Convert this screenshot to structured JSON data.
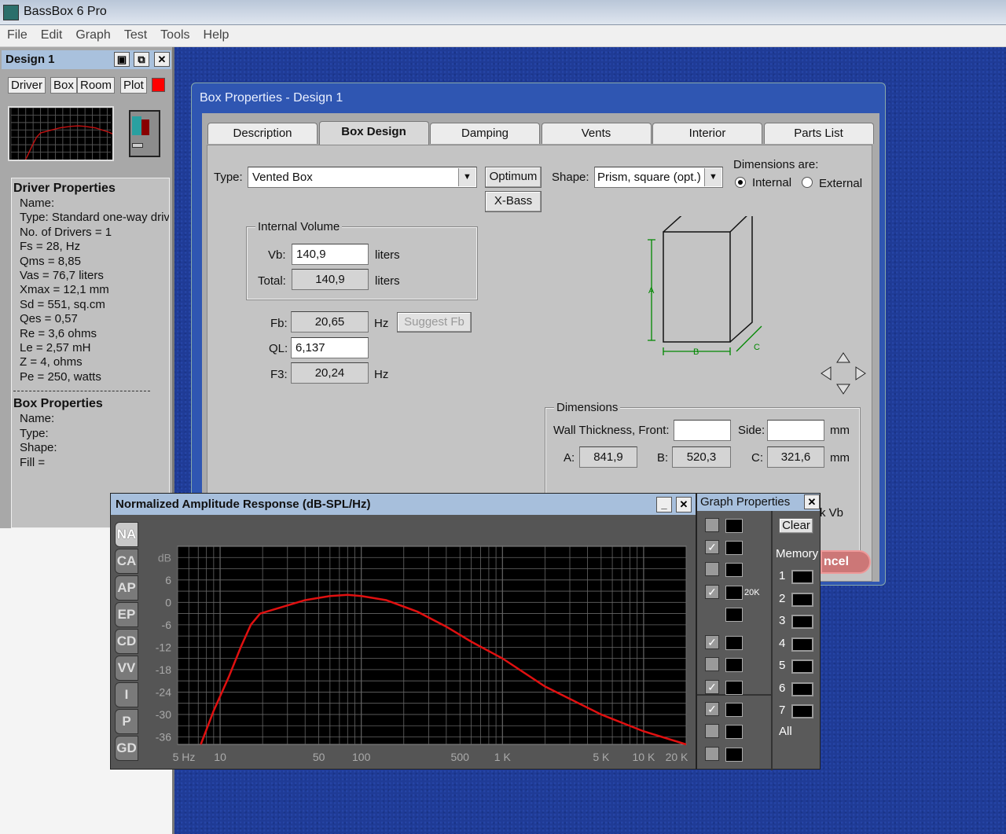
{
  "app": {
    "title": "BassBox 6 Pro"
  },
  "menu": [
    "File",
    "Edit",
    "Graph",
    "Test",
    "Tools",
    "Help"
  ],
  "design": {
    "title": "Design 1",
    "buttons": [
      "Driver",
      "Box",
      "Room",
      "Plot"
    ],
    "plot_color": "#ff0000",
    "driver_heading": "Driver Properties",
    "driver_lines": [
      "Name:",
      "Type: Standard one-way driver",
      "No. of Drivers = 1",
      "Fs =  28, Hz",
      "Qms =  8,85",
      "Vas =  76,7 liters",
      "Xmax =  12,1 mm",
      "Sd =  551, sq.cm",
      "Qes =  0,57",
      "Re =  3,6 ohms",
      "Le =  2,57 mH",
      "Z =  4, ohms",
      "Pe =  250, watts"
    ],
    "box_heading": "Box Properties",
    "box_lines": [
      "Name:",
      "Type:",
      "Shape:",
      "Fill ="
    ]
  },
  "dialog": {
    "title": "Box Properties - Design 1",
    "tabs": [
      "Description",
      "Box Design",
      "Damping",
      "Vents",
      "Interior",
      "Parts List"
    ],
    "selected_tab": "Box Design",
    "type_label": "Type:",
    "type_value": "Vented Box",
    "optimum": "Optimum",
    "xbass": "X-Bass",
    "shape_label": "Shape:",
    "shape_value": "Prism, square (opt.)",
    "dims_are": "Dimensions are:",
    "internal": "Internal",
    "external": "External",
    "dims_selected": "Internal",
    "iv_title": "Internal Volume",
    "vb_label": "Vb:",
    "vb": "140,9",
    "liters": "liters",
    "total_label": "Total:",
    "total": "140,9",
    "fb_label": "Fb:",
    "fb": "20,65",
    "hz": "Hz",
    "suggest_fb": "Suggest Fb",
    "ql_label": "QL:",
    "ql": "6,137",
    "f3_label": "F3:",
    "f3": "20,24",
    "diagram": {
      "a": "A",
      "b": "B",
      "c": "C"
    },
    "dims_title": "Dimensions",
    "wall_label": "Wall Thickness, Front:",
    "wall_front": "",
    "side_label": "Side:",
    "wall_side": "",
    "mm": "mm",
    "a_label": "A:",
    "a": "841,9",
    "b_label": "B:",
    "b": "520,3",
    "c_label": "C:",
    "c": "321,6",
    "partial_vb": "k Vb",
    "cancel_partial": "ncel"
  },
  "graph": {
    "title": "Normalized Amplitude Response (dB-SPL/Hz)",
    "tabs": [
      "NA",
      "CA",
      "AP",
      "EP",
      "CD",
      "VV",
      "I",
      "P",
      "GD"
    ],
    "selected_tab": "NA"
  },
  "chart_data": {
    "type": "line",
    "title": "Normalized Amplitude Response (dB-SPL/Hz)",
    "ylabel": "dB",
    "xscale": "log",
    "xlim": [
      5,
      20000
    ],
    "ylim": [
      -38,
      15
    ],
    "grid": true,
    "line_color": "#e01010",
    "xticks": [
      {
        "v": 5,
        "label": "5 Hz"
      },
      {
        "v": 10,
        "label": "10"
      },
      {
        "v": 50,
        "label": "50"
      },
      {
        "v": 100,
        "label": "100"
      },
      {
        "v": 500,
        "label": "500"
      },
      {
        "v": 1000,
        "label": "1 K"
      },
      {
        "v": 5000,
        "label": "5 K"
      },
      {
        "v": 10000,
        "label": "10 K"
      },
      {
        "v": 20000,
        "label": "20 K"
      }
    ],
    "yticks": [
      6,
      0,
      -6,
      -12,
      -18,
      -24,
      -30,
      -36
    ],
    "x": [
      7.3,
      9,
      11.5,
      14,
      16.5,
      19.2,
      25,
      40,
      60,
      80,
      100,
      150,
      250,
      400,
      600,
      1000,
      2000,
      5000,
      10000,
      20000
    ],
    "y": [
      -38,
      -29,
      -20,
      -12,
      -6,
      -3,
      -1.7,
      0.6,
      1.7,
      2,
      1.7,
      0.6,
      -2.5,
      -6.5,
      -10.5,
      -15,
      -22.5,
      -30,
      -34.5,
      -38
    ]
  },
  "graph_props": {
    "title": "Graph Properties",
    "clear": "Clear",
    "memory": "Memory",
    "memory_slots": [
      "1",
      "2",
      "3",
      "4",
      "5",
      "6",
      "7"
    ],
    "all": "All",
    "options": [
      {
        "icon": "crosshair-icon",
        "checked": false
      },
      {
        "icon": "grid-icon",
        "checked": true
      },
      {
        "icon": "auto-scale-icon",
        "checked": false
      },
      {
        "icon": "extend-20k-icon",
        "checked": true
      },
      {
        "icon": "resize-icon",
        "checked": null
      },
      {
        "icon": "driver-response-icon",
        "checked": true
      },
      {
        "icon": "box-response-icon",
        "checked": false
      },
      {
        "icon": "room-response-icon",
        "checked": true
      },
      {
        "icon": "crossover-icon",
        "checked": true
      },
      {
        "icon": "driver-measured-icon",
        "checked": false
      },
      {
        "icon": "mic-measured-icon",
        "checked": false
      }
    ],
    "extend_label": "20K"
  }
}
